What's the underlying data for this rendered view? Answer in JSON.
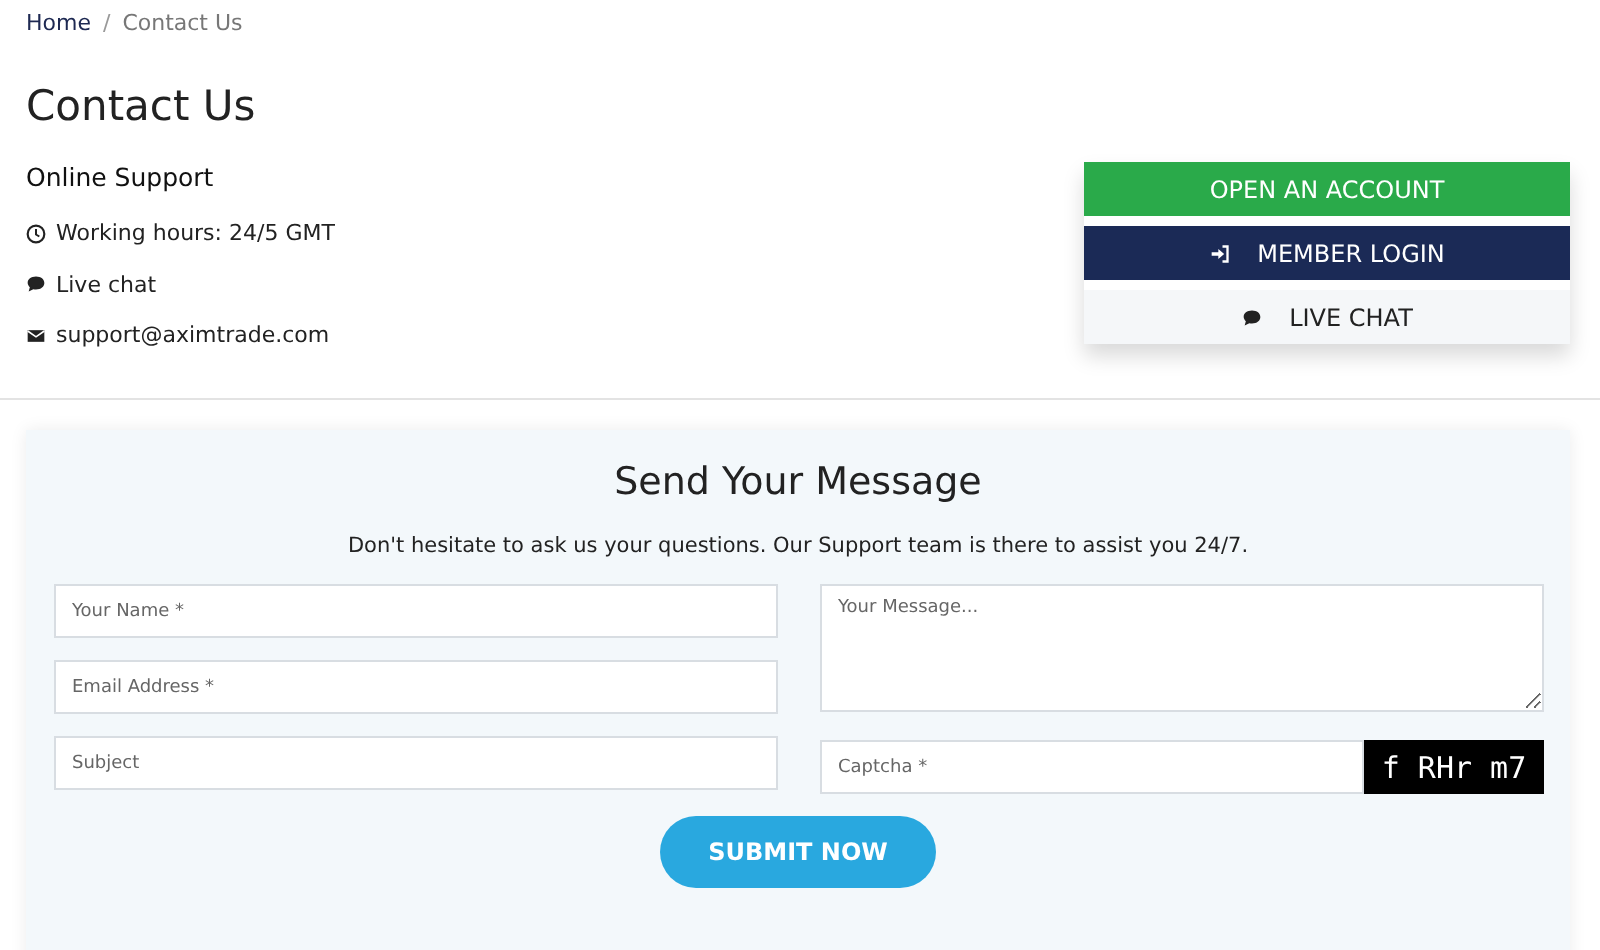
{
  "breadcrumb_separator": "/",
  "breadcrumb": [
    {
      "label": "Home",
      "current": false
    },
    {
      "label": "Contact Us",
      "current": true
    }
  ],
  "title": "Contact Us",
  "support": {
    "heading": "Online Support",
    "items": [
      {
        "kind": "clock",
        "text": "Working hours: 24/5 GMT"
      },
      {
        "kind": "chat",
        "text": "Live chat"
      },
      {
        "kind": "mail",
        "text": "support@aximtrade.com"
      }
    ]
  },
  "actions": [
    {
      "kind": "primary",
      "label": "OPEN AN ACCOUNT"
    },
    {
      "kind": "login",
      "label": "MEMBER LOGIN"
    },
    {
      "kind": "chat",
      "label": "LIVE CHAT"
    }
  ],
  "form": {
    "title": "Send Your Message",
    "intro": "Don't hesitate to ask us your questions. Our Support team is there to assist you 24/7.",
    "left_fields": [
      {
        "placeholder": "Your Name *"
      },
      {
        "placeholder": "Email Address *"
      },
      {
        "placeholder": "Subject"
      }
    ],
    "message": {
      "placeholder": "Your Message..."
    },
    "captcha": {
      "placeholder": "Captcha *",
      "image_text": "f RHr m7"
    },
    "submit": "SUBMIT NOW"
  }
}
